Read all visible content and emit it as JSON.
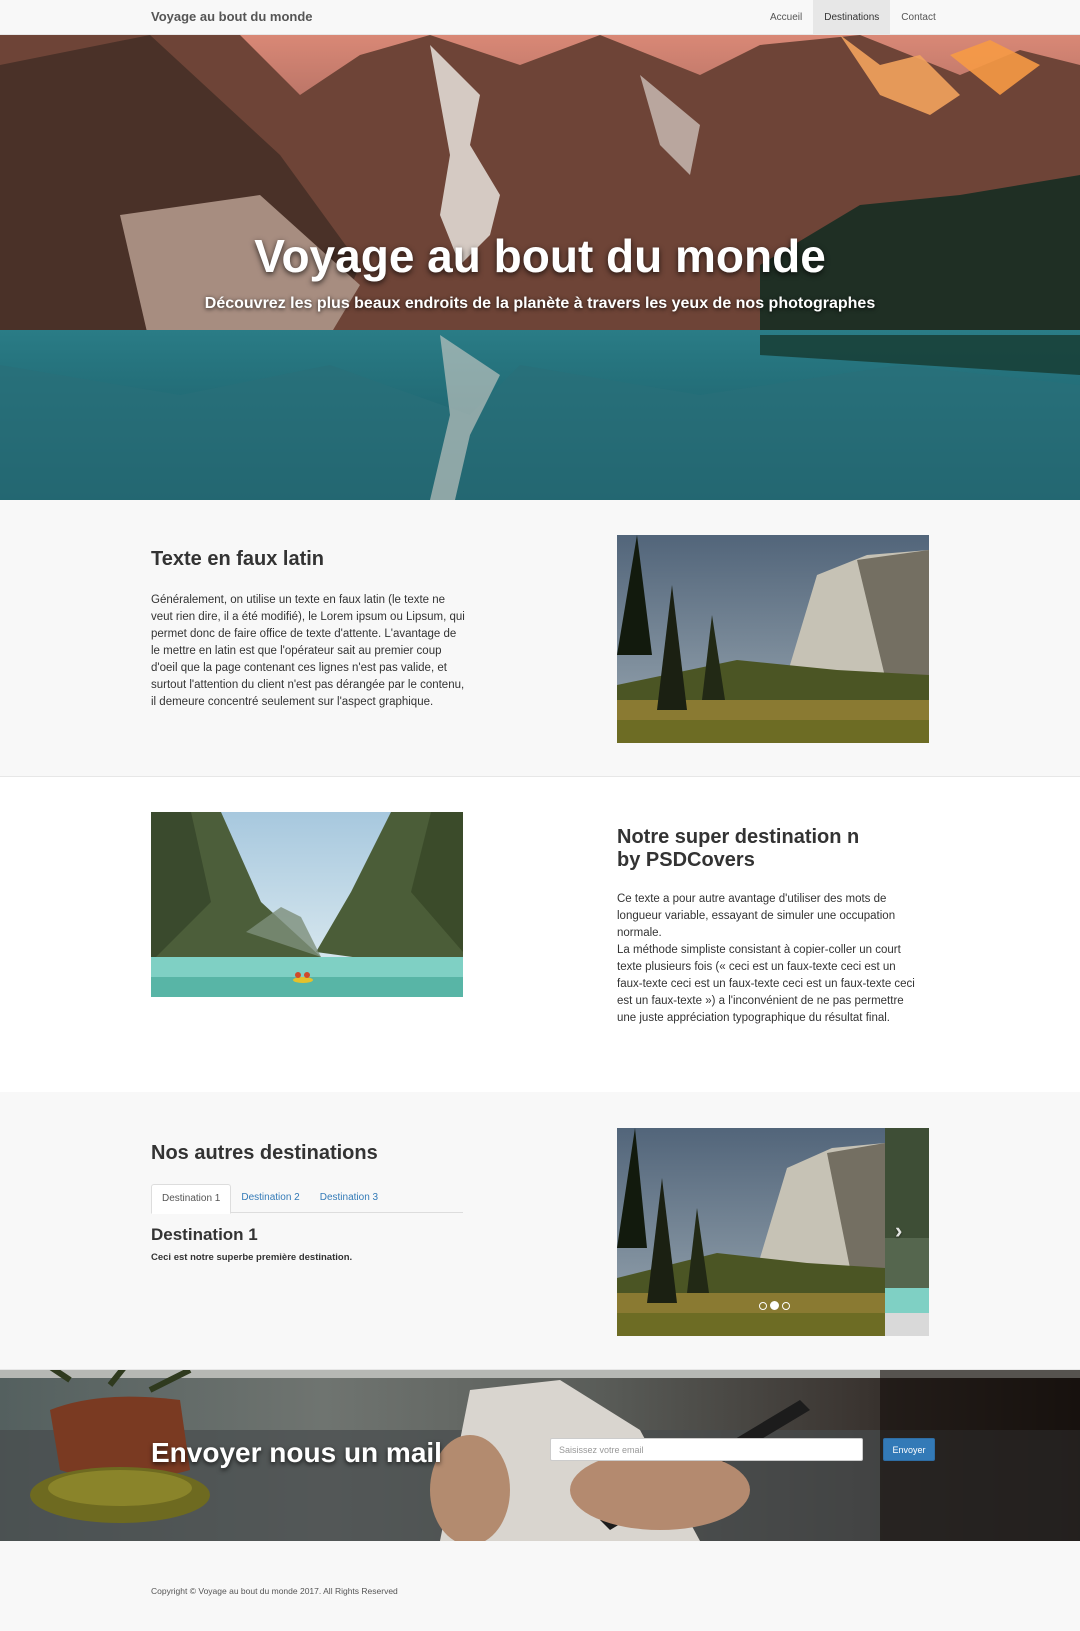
{
  "navbar": {
    "brand": "Voyage au bout du monde",
    "links": [
      {
        "label": "Accueil",
        "active": false
      },
      {
        "label": "Destinations",
        "active": true
      },
      {
        "label": "Contact",
        "active": false
      }
    ]
  },
  "hero": {
    "title": "Voyage au bout du monde",
    "subtitle": "Découvrez les plus beaux endroits de la planète à travers les yeux de nos photographes"
  },
  "section1": {
    "heading": "Texte en faux latin",
    "paragraph": "Généralement, on utilise un texte en faux latin (le texte ne veut rien dire, il a été modifié), le Lorem ipsum ou Lipsum, qui permet donc de faire office de texte d'attente. L'avantage de le mettre en latin est que l'opérateur sait au premier coup d'oeil que la page contenant ces lignes n'est pas valide, et surtout l'attention du client n'est pas dérangée par le contenu, il demeure concentré seulement sur l'aspect graphique."
  },
  "section2": {
    "heading_line1": "Notre super destination n",
    "heading_line2": "by PSDCovers",
    "paragraph_1": "Ce texte a pour autre avantage d'utiliser des mots de longueur variable, essayant de simuler une occupation normale.",
    "paragraph_2": "La méthode simpliste consistant à copier-coller un court texte plusieurs fois (« ceci est un faux-texte ceci est un faux-texte ceci est un faux-texte ceci est un faux-texte ceci est un faux-texte ») a l'inconvénient de ne pas permettre une juste appréciation typographique du résultat final."
  },
  "section3": {
    "heading": "Nos autres destinations",
    "tabs": [
      {
        "label": "Destination 1",
        "active": true
      },
      {
        "label": "Destination 2",
        "active": false
      },
      {
        "label": "Destination 3",
        "active": false
      }
    ],
    "tab_content_title": "Destination 1",
    "tab_content_text": "Ceci est notre superbe première destination.",
    "carousel": {
      "slide_count": 3,
      "active_index": 1,
      "next_arrow": "›"
    }
  },
  "mail": {
    "title": "Envoyer nous un mail",
    "placeholder": "Saisissez votre email",
    "button": "Envoyer"
  },
  "footer": {
    "copyright": "Copyright © Voyage au bout du monde 2017. All Rights Reserved"
  },
  "colors": {
    "accent": "#337ab7",
    "navbar_bg": "#f8f8f8",
    "text": "#333333"
  }
}
